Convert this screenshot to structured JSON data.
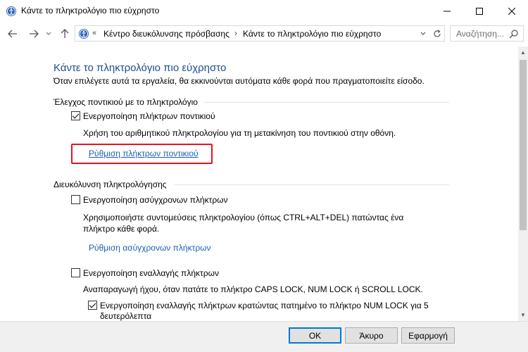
{
  "window": {
    "title": "Κάντε το πληκτρολόγιο πιο εύχρηστο"
  },
  "address_bar": {
    "overflow": "«",
    "crumbs": [
      "Κέντρο διευκόλυνσης πρόσβασης",
      "Κάντε το πληκτρολόγιο πιο εύχρηστο"
    ],
    "separator": "›"
  },
  "search": {
    "placeholder": "Αναζήτηση..."
  },
  "page": {
    "title": "Κάντε το πληκτρολόγιο πιο εύχρηστο",
    "subtitle": "Όταν επιλέγετε αυτά τα εργαλεία, θα εκκινούνται αυτόματα κάθε φορά που πραγματοποιείτε είσοδο."
  },
  "mouse_section": {
    "heading": "Έλεγχος ποντικιού με το πληκτρολόγιο",
    "checkbox_label": "Ενεργοποίηση πλήκτρων ποντικιού",
    "checked": true,
    "description": "Χρήση του αριθμητικού πληκτρολογίου για τη μετακίνηση του ποντικιού στην οθόνη.",
    "link": "Ρύθμιση πλήκτρων ποντικιού"
  },
  "typing_section": {
    "heading": "Διευκόλυνση πληκτρολόγησης",
    "sticky": {
      "label": "Ενεργοποίηση ασύγχρονων πλήκτρων",
      "checked": false,
      "description": "Χρησιμοποιήστε συντομεύσεις πληκτρολογίου (όπως CTRL+ALT+DEL) πατώντας ένα πλήκτρο κάθε φορά.",
      "link": "Ρύθμιση ασύγχρονων πλήκτρων"
    },
    "toggle": {
      "label": "Ενεργοποίηση εναλλαγής πλήκτρων",
      "checked": false,
      "description": "Αναπαραγωγή ήχου, όταν πατάτε το πλήκτρο CAPS LOCK, NUM LOCK ή SCROLL LOCK.",
      "sub_label": "Ενεργοποίηση εναλλαγής πλήκτρων κρατώντας πατημένο το πλήκτρο NUM LOCK για 5 δευτερόλεπτα",
      "sub_checked": true
    }
  },
  "buttons": {
    "ok": "OK",
    "cancel": "Άκυρο",
    "apply": "Εφαρμογή"
  },
  "colors": {
    "title_blue": "#1e4e8c",
    "link_blue": "#1a5fb4",
    "highlight_red": "#e81123"
  },
  "icons": {
    "window": "ease-of-access-icon",
    "address": "ease-of-access-icon",
    "search": "search-icon"
  }
}
